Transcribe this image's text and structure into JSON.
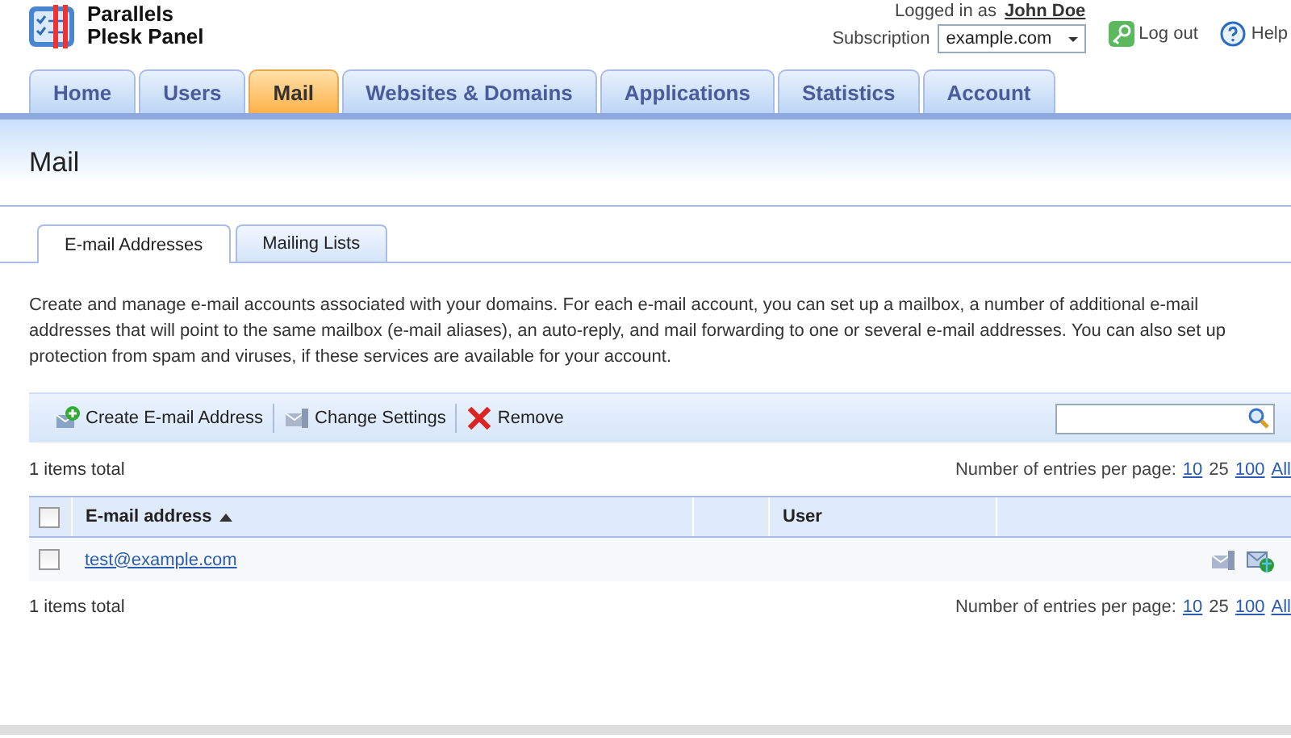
{
  "header": {
    "logo_line_1": "Parallels",
    "logo_line_2": "Plesk Panel",
    "logged_in_label": "Logged in as",
    "user_name": "John Doe",
    "subscription_label": "Subscription",
    "subscription_value": "example.com",
    "logout": "Log out",
    "help": "Help"
  },
  "tabs": [
    {
      "label": "Home",
      "selected": false
    },
    {
      "label": "Users",
      "selected": false
    },
    {
      "label": "Mail",
      "selected": true
    },
    {
      "label": "Websites & Domains",
      "selected": false
    },
    {
      "label": "Applications",
      "selected": false
    },
    {
      "label": "Statistics",
      "selected": false
    },
    {
      "label": "Account",
      "selected": false
    }
  ],
  "page_title": "Mail",
  "subtabs": [
    {
      "label": "E-mail Addresses",
      "selected": true
    },
    {
      "label": "Mailing Lists",
      "selected": false
    }
  ],
  "description": "Create and manage e-mail accounts associated with your domains. For each e-mail account, you can set up a mailbox, a number of additional e-mail addresses that will point to the same mailbox (e-mail aliases), an auto-reply, and mail forwarding to one or several e-mail addresses. You can also set up protection from spam and viruses, if these services are available for your account.",
  "toolbar": [
    {
      "label": "Create E-mail Address",
      "kind": "create"
    },
    {
      "label": "Change Settings",
      "kind": "settings"
    },
    {
      "label": "Remove",
      "kind": "remove"
    }
  ],
  "total_top": "1 items total",
  "per_page_top": {
    "label": "Number of entries per page:",
    "options": [
      {
        "label": "10",
        "selected": false
      },
      {
        "label": "25",
        "selected": true
      },
      {
        "label": "100",
        "selected": false
      },
      {
        "label": "All",
        "selected": false
      }
    ]
  },
  "table": {
    "select_all_checked": false,
    "columns": [
      {
        "label": "E-mail address",
        "sorted": true
      },
      {
        "label": "User",
        "sorted": false
      }
    ],
    "rows": [
      {
        "checked": false,
        "email": "test@example.com"
      }
    ]
  },
  "total_bottom": "1 items total",
  "per_page_bottom": {
    "label": "Number of entries per page:",
    "options": [
      {
        "label": "10",
        "selected": false
      },
      {
        "label": "25",
        "selected": true
      },
      {
        "label": "100",
        "selected": false
      },
      {
        "label": "All",
        "selected": false
      }
    ]
  }
}
